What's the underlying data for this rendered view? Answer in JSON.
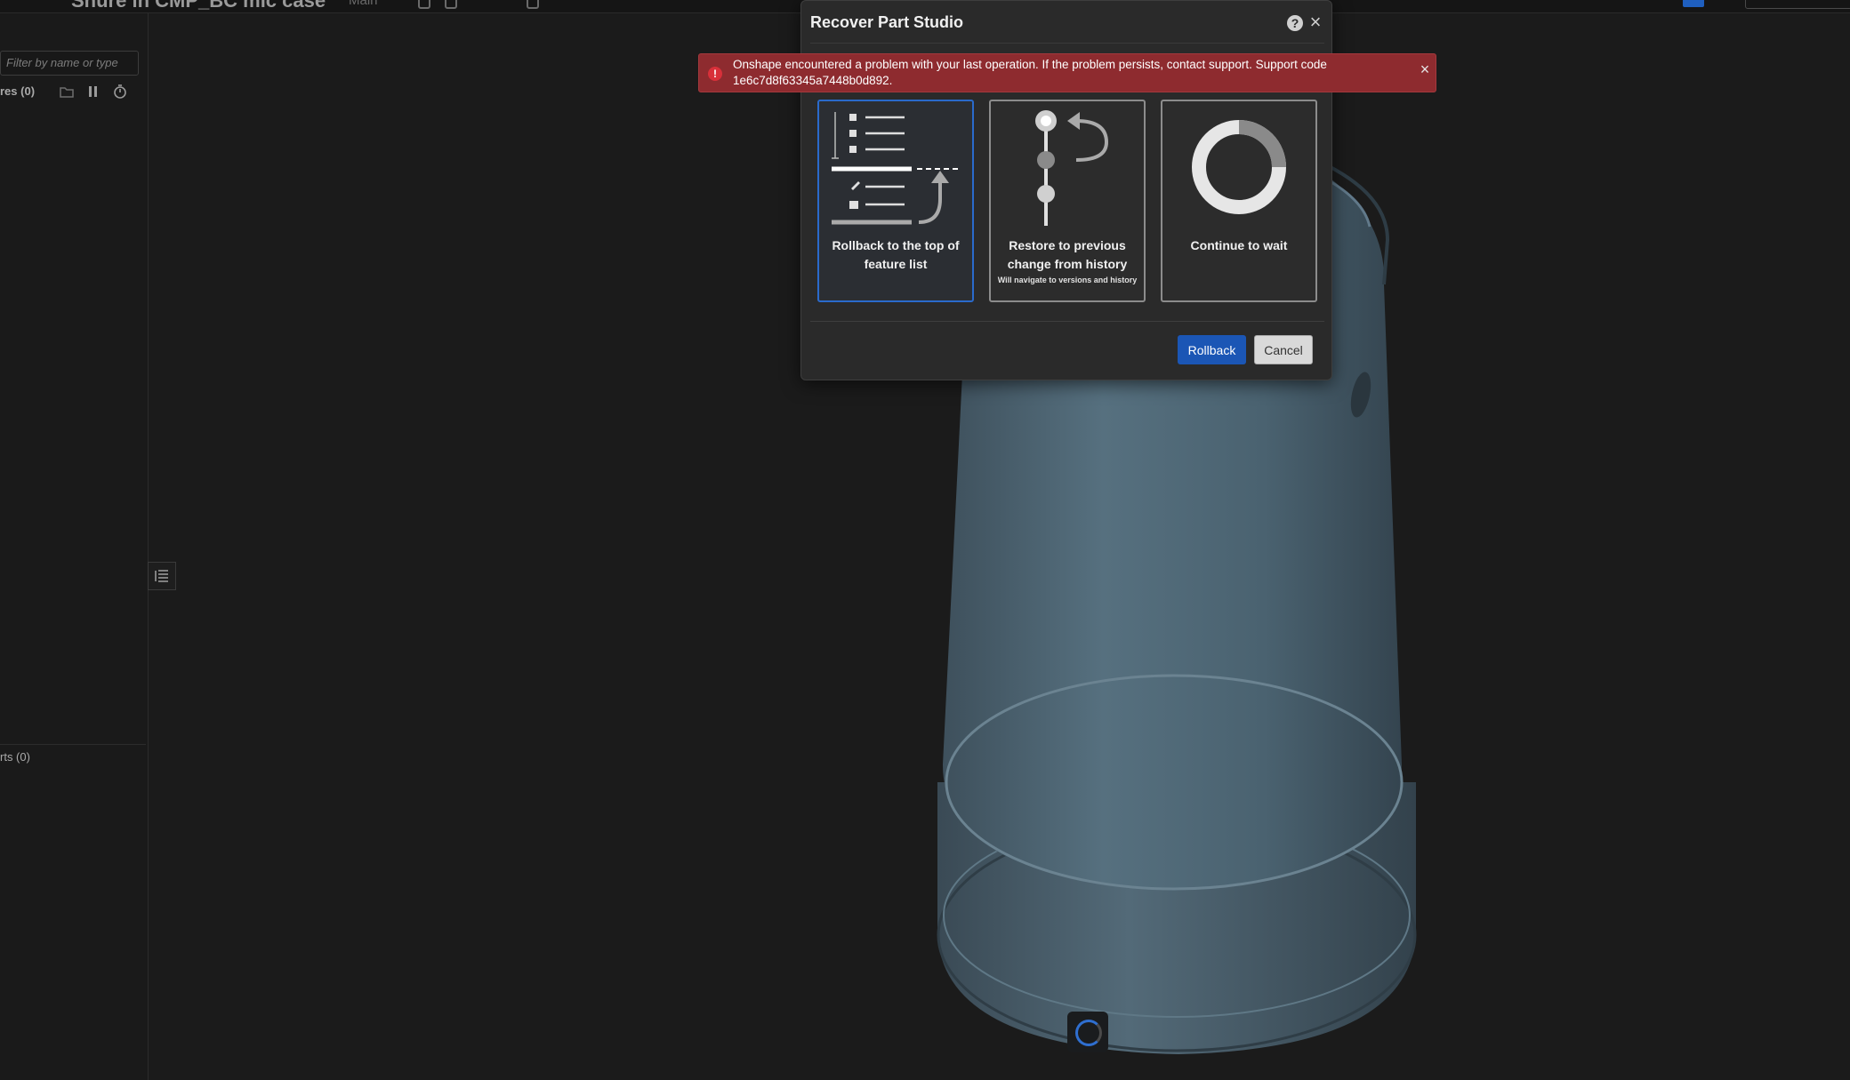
{
  "topbar": {
    "document_title": "Shure in CMP_BC mic case",
    "branch": "Main"
  },
  "left_panel": {
    "filter_placeholder": "Filter by name or type",
    "features_label": "res (0)",
    "parts_label": "rts (0)"
  },
  "dialog": {
    "title": "Recover Part Studio",
    "help_icon": "?",
    "close_icon": "×",
    "options": [
      {
        "label": "Rollback to the top of feature list",
        "sublabel": "",
        "selected": true
      },
      {
        "label": "Restore to previous change from history",
        "sublabel": "Will navigate to versions and history",
        "selected": false
      },
      {
        "label": "Continue to wait",
        "sublabel": "",
        "selected": false
      }
    ],
    "rollback_button": "Rollback",
    "cancel_button": "Cancel"
  },
  "error": {
    "message": "Onshape encountered a problem with your last operation. If the problem persists, contact support. Support code 1e6c7d8f63345a7448b0d892.",
    "icon": "!",
    "close_icon": "×"
  },
  "colors": {
    "accent": "#1b56b5",
    "error": "#8e2b2f",
    "model": "#4a6070"
  }
}
